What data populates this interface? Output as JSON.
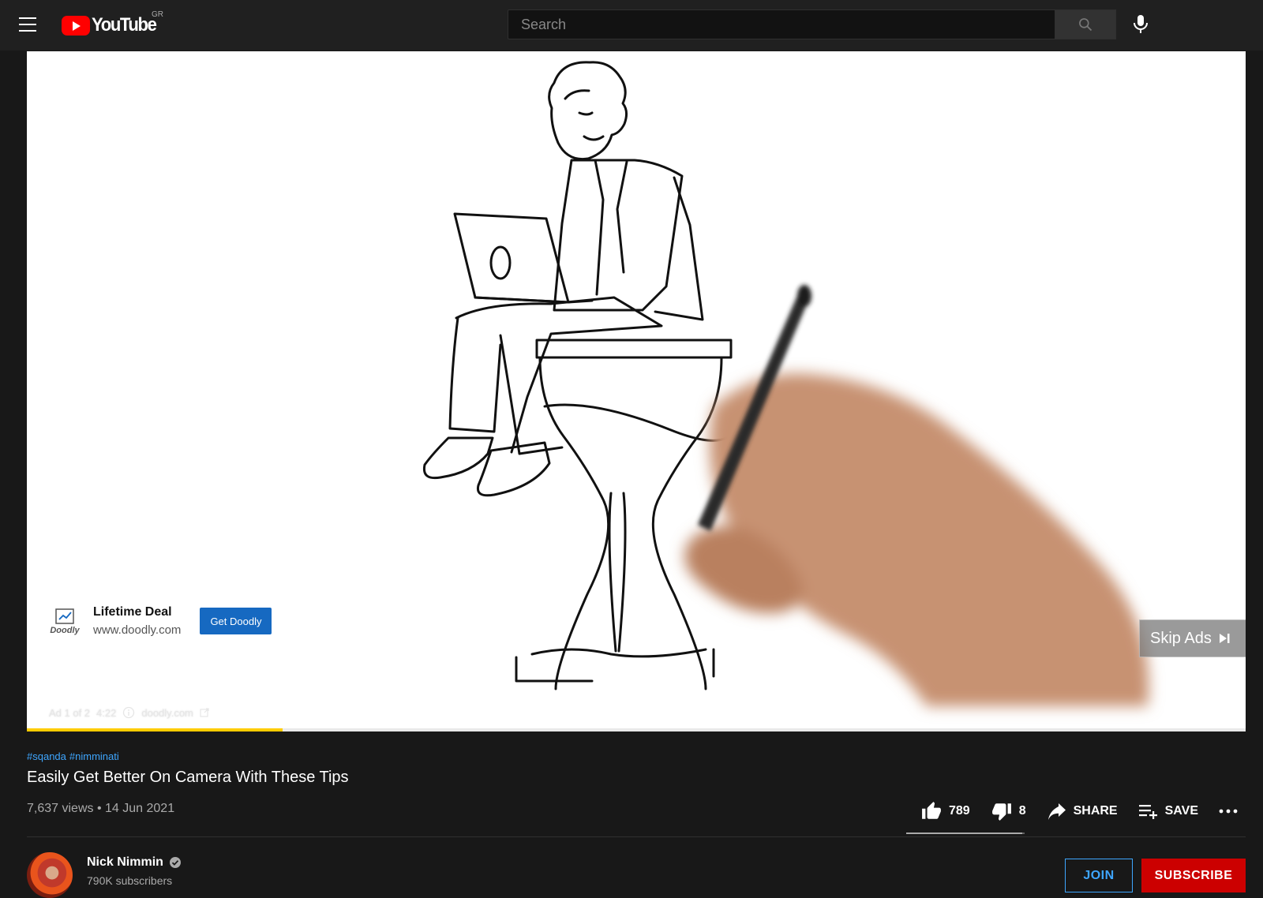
{
  "masthead": {
    "logo_text": "YouTube",
    "country_code": "GR",
    "search_placeholder": "Search"
  },
  "player": {
    "ad": {
      "brand_logo_text": "Doodly",
      "title": "Lifetime Deal",
      "url": "www.doodly.com",
      "cta_label": "Get Doodly"
    },
    "skip_label": "Skip Ads",
    "ad_info": {
      "position": "Ad 1 of 2",
      "duration": "4:22",
      "domain": "doodly.com"
    },
    "ad_progress": 0.21
  },
  "video": {
    "hashtags": [
      "#sqanda",
      "#nimminati"
    ],
    "title": "Easily Get Better On Camera With These Tips",
    "views": "7,637 views",
    "separator": "•",
    "date": "14 Jun 2021",
    "actions": {
      "likes": "789",
      "dislikes": "8",
      "share_label": "SHARE",
      "save_label": "SAVE"
    },
    "like_ratio": 0.98
  },
  "channel": {
    "name": "Nick Nimmin",
    "subscribers": "790K subscribers",
    "join_label": "JOIN",
    "subscribe_label": "SUBSCRIBE"
  },
  "icons": [
    "menu-icon",
    "youtube-logo-icon",
    "search-icon",
    "mic-icon",
    "skip-icon",
    "info-icon",
    "external-link-icon",
    "thumb-up-icon",
    "thumb-down-icon",
    "share-icon",
    "playlist-add-icon",
    "more-icon",
    "verified-icon"
  ],
  "colors": {
    "accent_red": "#ff0000",
    "subscribe_red": "#cc0000",
    "link_blue": "#3ea6ff",
    "ad_progress_yellow": "#ffcc00",
    "cta_blue": "#1669c1"
  }
}
